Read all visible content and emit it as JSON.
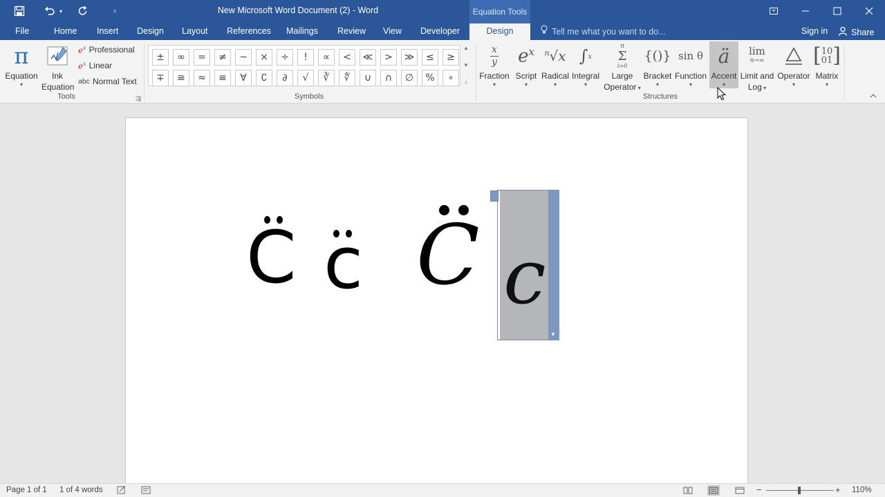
{
  "window": {
    "title": "New Microsoft Word Document (2) - Word",
    "context_tab_group": "Equation Tools",
    "controls": [
      "restore-ribbon-icon",
      "minimize-icon",
      "maximize-icon",
      "close-icon"
    ]
  },
  "tabs": [
    {
      "label": "File"
    },
    {
      "label": "Home"
    },
    {
      "label": "Insert"
    },
    {
      "label": "Design"
    },
    {
      "label": "Layout"
    },
    {
      "label": "References"
    },
    {
      "label": "Mailings"
    },
    {
      "label": "Review"
    },
    {
      "label": "View"
    },
    {
      "label": "Developer"
    },
    {
      "label": "Design"
    }
  ],
  "active_tab_index": 10,
  "tell_me": {
    "placeholder": "Tell me what you want to do..."
  },
  "account": {
    "sign_in": "Sign in",
    "share": "Share"
  },
  "ribbon": {
    "tools": {
      "label": "Tools",
      "equation": "Equation",
      "ink_equation_line1": "Ink",
      "ink_equation_line2": "Equation",
      "professional": "Professional",
      "linear": "Linear",
      "normal_text": "Normal Text",
      "normal_text_prefix": "abc"
    },
    "symbols": {
      "label": "Symbols",
      "row1": [
        "±",
        "∞",
        "=",
        "≠",
        "~",
        "×",
        "÷",
        "!",
        "∝",
        "<",
        "≪",
        ">",
        "≫",
        "≤",
        "≥"
      ],
      "row2": [
        "∓",
        "≅",
        "≈",
        "≡",
        "∀",
        "∁",
        "∂",
        "√",
        "∛",
        "∜",
        "∪",
        "∩",
        "∅",
        "%",
        "∘"
      ]
    },
    "structures": {
      "label": "Structures",
      "items": [
        {
          "line1": "Fraction",
          "line2": ""
        },
        {
          "line1": "Script",
          "line2": ""
        },
        {
          "line1": "Radical",
          "line2": ""
        },
        {
          "line1": "Integral",
          "line2": ""
        },
        {
          "line1": "Large",
          "line2": "Operator"
        },
        {
          "line1": "Bracket",
          "line2": ""
        },
        {
          "line1": "Function",
          "line2": ""
        },
        {
          "line1": "Accent",
          "line2": ""
        },
        {
          "line1": "Limit and",
          "line2": "Log"
        },
        {
          "line1": "Operator",
          "line2": ""
        },
        {
          "line1": "Matrix",
          "line2": ""
        }
      ],
      "hovered": "Accent"
    }
  },
  "document": {
    "glyphs": [
      "C",
      "c",
      "C",
      "c"
    ]
  },
  "status": {
    "page": "Page 1 of 1",
    "words": "1 of 4 words",
    "zoom": "110%",
    "zoom_minus": "−",
    "zoom_plus": "+"
  }
}
